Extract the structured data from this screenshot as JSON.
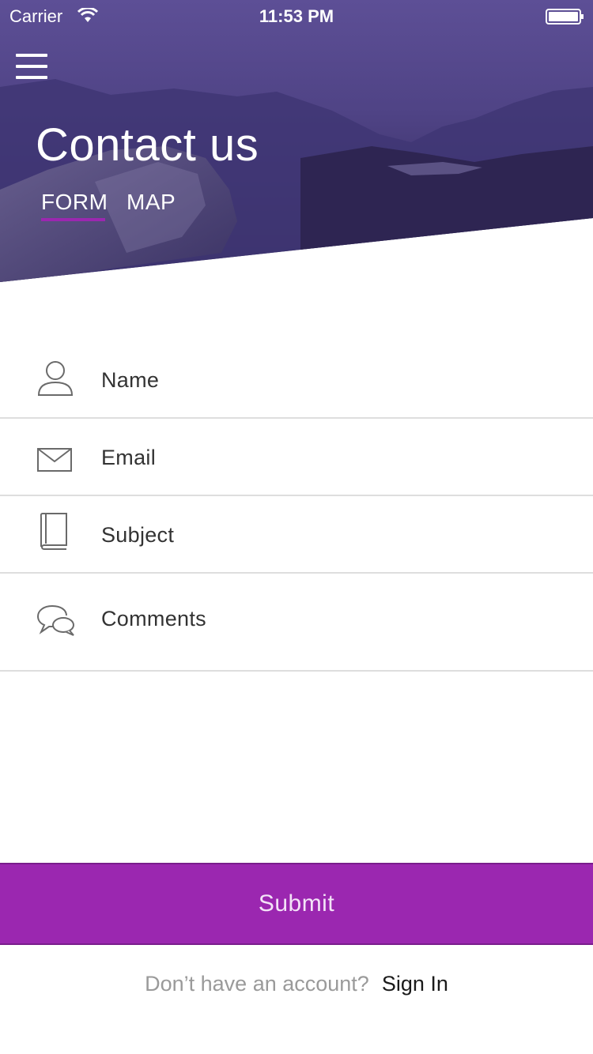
{
  "status_bar": {
    "carrier": "Carrier",
    "time": "11:53 PM",
    "wifi_icon": "wifi-icon",
    "battery_icon": "battery-icon"
  },
  "header": {
    "menu_icon": "hamburger-menu-icon",
    "title": "Contact us",
    "tabs": [
      {
        "label": "FORM",
        "active": true
      },
      {
        "label": "MAP",
        "active": false
      }
    ]
  },
  "form": {
    "fields": [
      {
        "placeholder": "Name",
        "icon": "person-icon"
      },
      {
        "placeholder": "Email",
        "icon": "envelope-icon"
      },
      {
        "placeholder": "Subject",
        "icon": "book-icon"
      },
      {
        "placeholder": "Comments",
        "icon": "chat-bubbles-icon"
      }
    ]
  },
  "submit_label": "Submit",
  "footer": {
    "prompt": "Don’t have an account?",
    "link": "Sign In"
  },
  "colors": {
    "accent": "#9b27b0",
    "header_overlay": "#4a3d86"
  }
}
